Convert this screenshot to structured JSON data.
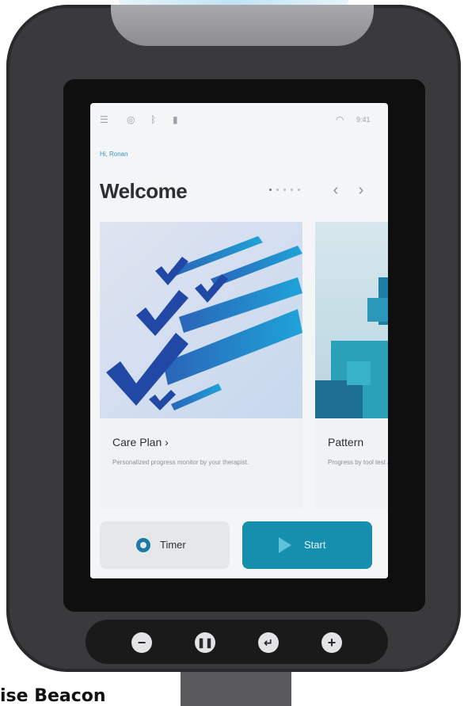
{
  "status_bar": {
    "icons": [
      "menu-icon",
      "grid-icon",
      "bluetooth-icon",
      "battery-icon",
      "wifi-icon"
    ],
    "time": "9:41"
  },
  "breadcrumb": "Hi, Ronan",
  "page": {
    "title": "Welcome"
  },
  "carousel": {
    "page_count": 5,
    "active_index": 0,
    "prev_icon": "chevron-left-icon",
    "next_icon": "chevron-right-icon",
    "cards": [
      {
        "title": "Care Plan  ›",
        "description": "Personalized progress monitor by your therapist."
      },
      {
        "title": "Pattern",
        "description": "Progress by tool test and tips"
      }
    ]
  },
  "actions": {
    "timer_label": "Timer",
    "start_label": "Start"
  },
  "hardware_buttons": [
    "minus-icon",
    "pause-icon",
    "back-icon",
    "plus-icon"
  ],
  "caption": "ise Beacon",
  "colors": {
    "accent": "#168fae",
    "accent_dark": "#1a7aa6",
    "device_body": "#3a3a3c"
  }
}
